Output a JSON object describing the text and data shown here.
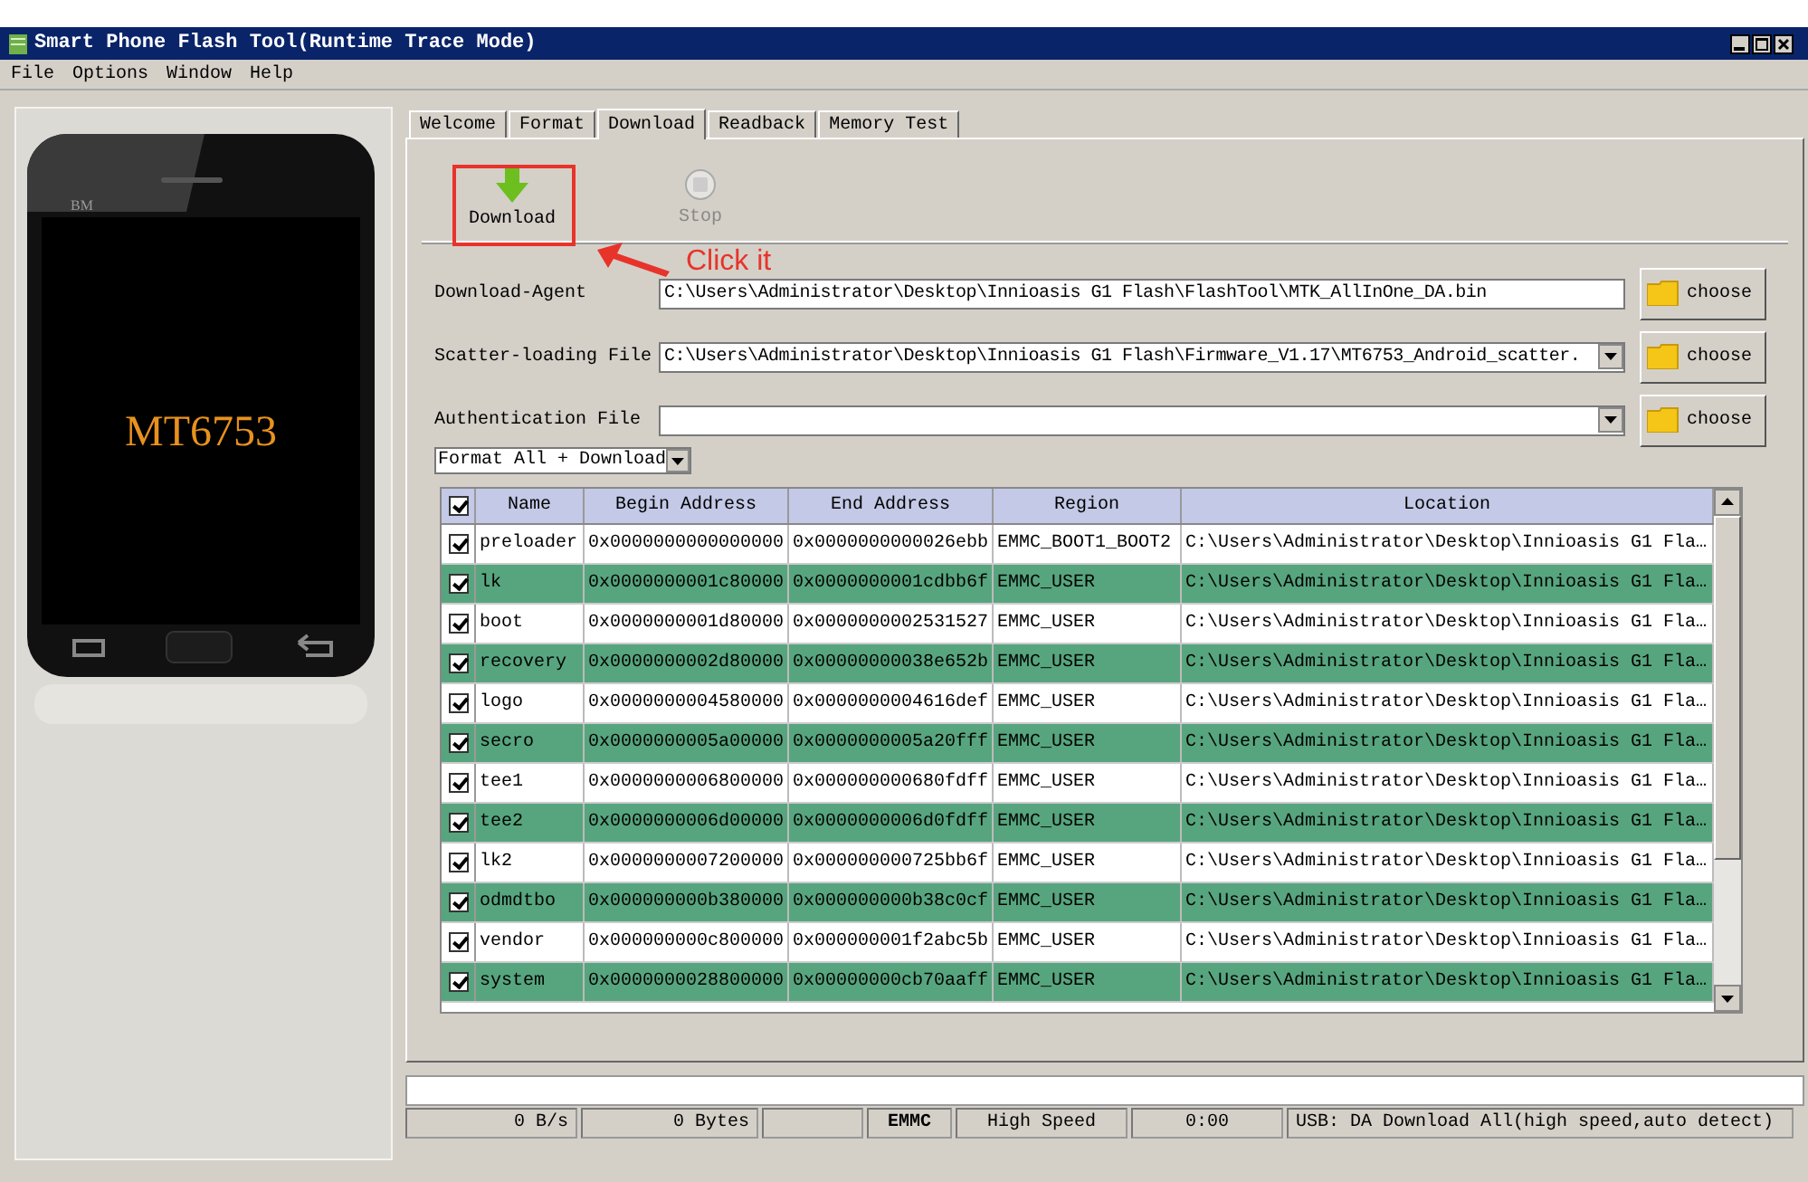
{
  "window": {
    "title": "Smart Phone Flash Tool(Runtime Trace Mode)"
  },
  "menu": [
    "File",
    "Options",
    "Window",
    "Help"
  ],
  "phone": {
    "brand": "BM",
    "chip": "MT6753"
  },
  "tabs": [
    {
      "label": "Welcome",
      "selected": false
    },
    {
      "label": "Format",
      "selected": false
    },
    {
      "label": "Download",
      "selected": true
    },
    {
      "label": "Readback",
      "selected": false
    },
    {
      "label": "Memory Test",
      "selected": false
    }
  ],
  "toolbar": [
    {
      "kind": "download",
      "label": "Download",
      "disabled": false
    },
    {
      "kind": "stop",
      "label": "Stop",
      "disabled": true
    }
  ],
  "annotation": {
    "text": "Click it"
  },
  "fields": [
    {
      "kind": "text",
      "label": "Download-Agent",
      "value": "C:\\Users\\Administrator\\Desktop\\Innioasis G1 Flash\\FlashTool\\MTK_AllInOne_DA.bin",
      "button": "choose"
    },
    {
      "kind": "combo",
      "label": "Scatter-loading File",
      "value": "C:\\Users\\Administrator\\Desktop\\Innioasis G1 Flash\\Firmware_V1.17\\MT6753_Android_scatter.",
      "button": "choose"
    },
    {
      "kind": "combo",
      "label": "Authentication File",
      "button": "choose"
    }
  ],
  "mode": {
    "value": "Format All + Download"
  },
  "table": {
    "all_checked": true,
    "columns": [
      "Name",
      "Begin Address",
      "End Address",
      "Region",
      "Location"
    ],
    "rows": [
      {
        "checked": true,
        "cells": [
          "preloader",
          "0x0000000000000000",
          "0x0000000000026ebb",
          "EMMC_BOOT1_BOOT2",
          "C:\\Users\\Administrator\\Desktop\\Innioasis G1 Fla…"
        ]
      },
      {
        "checked": true,
        "cells": [
          "lk",
          "0x0000000001c80000",
          "0x0000000001cdbb6f",
          "EMMC_USER",
          "C:\\Users\\Administrator\\Desktop\\Innioasis G1 Fla…"
        ]
      },
      {
        "checked": true,
        "cells": [
          "boot",
          "0x0000000001d80000",
          "0x0000000002531527",
          "EMMC_USER",
          "C:\\Users\\Administrator\\Desktop\\Innioasis G1 Fla…"
        ]
      },
      {
        "checked": true,
        "cells": [
          "recovery",
          "0x0000000002d80000",
          "0x00000000038e652b",
          "EMMC_USER",
          "C:\\Users\\Administrator\\Desktop\\Innioasis G1 Fla…"
        ]
      },
      {
        "checked": true,
        "cells": [
          "logo",
          "0x0000000004580000",
          "0x0000000004616def",
          "EMMC_USER",
          "C:\\Users\\Administrator\\Desktop\\Innioasis G1 Fla…"
        ]
      },
      {
        "checked": true,
        "cells": [
          "secro",
          "0x0000000005a00000",
          "0x0000000005a20fff",
          "EMMC_USER",
          "C:\\Users\\Administrator\\Desktop\\Innioasis G1 Fla…"
        ]
      },
      {
        "checked": true,
        "cells": [
          "tee1",
          "0x0000000006800000",
          "0x000000000680fdff",
          "EMMC_USER",
          "C:\\Users\\Administrator\\Desktop\\Innioasis G1 Fla…"
        ]
      },
      {
        "checked": true,
        "cells": [
          "tee2",
          "0x0000000006d00000",
          "0x0000000006d0fdff",
          "EMMC_USER",
          "C:\\Users\\Administrator\\Desktop\\Innioasis G1 Fla…"
        ]
      },
      {
        "checked": true,
        "cells": [
          "lk2",
          "0x0000000007200000",
          "0x000000000725bb6f",
          "EMMC_USER",
          "C:\\Users\\Administrator\\Desktop\\Innioasis G1 Fla…"
        ]
      },
      {
        "checked": true,
        "cells": [
          "odmdtbo",
          "0x000000000b380000",
          "0x000000000b38c0cf",
          "EMMC_USER",
          "C:\\Users\\Administrator\\Desktop\\Innioasis G1 Fla…"
        ]
      },
      {
        "checked": true,
        "cells": [
          "vendor",
          "0x000000000c800000",
          "0x000000001f2abc5b",
          "EMMC_USER",
          "C:\\Users\\Administrator\\Desktop\\Innioasis G1 Fla…"
        ]
      },
      {
        "checked": true,
        "cells": [
          "system",
          "0x0000000028800000",
          "0x00000000cb70aaff",
          "EMMC_USER",
          "C:\\Users\\Administrator\\Desktop\\Innioasis G1 Fla…"
        ]
      }
    ]
  },
  "progress": {
    "level": 0
  },
  "status_bar": [
    {
      "kind": "speed",
      "text": "0 B/s"
    },
    {
      "kind": "bytes",
      "text": "0 Bytes"
    },
    {
      "kind": "blank"
    },
    {
      "kind": "storage",
      "text": "EMMC"
    },
    {
      "kind": "speed-mode",
      "text": "High Speed"
    },
    {
      "kind": "time",
      "text": "0:00"
    },
    {
      "kind": "connection",
      "text": "USB: DA Download All(high speed,auto detect)"
    }
  ]
}
